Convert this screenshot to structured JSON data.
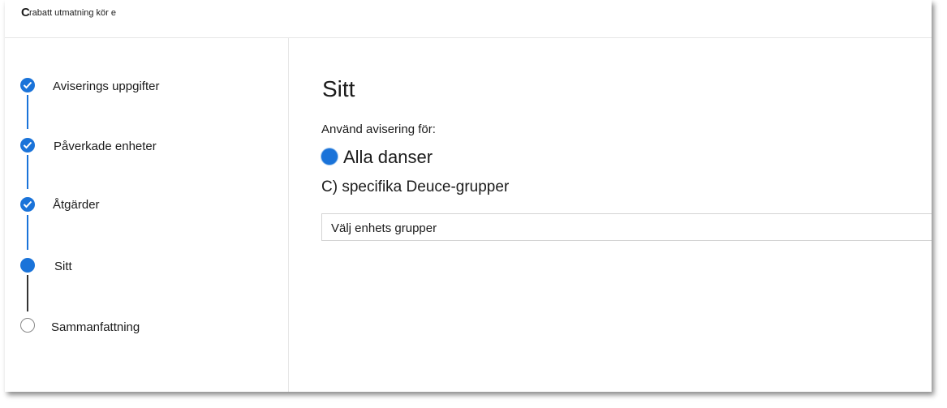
{
  "window": {
    "title_initial": "C",
    "title": "rabatt utmatning kör e"
  },
  "steps": [
    {
      "label": "Aviserings uppgifter",
      "state": "done"
    },
    {
      "label": "Påverkade enheter",
      "state": "done"
    },
    {
      "label": "Åtgärder",
      "state": "done"
    },
    {
      "label": "Sitt",
      "state": "current"
    },
    {
      "label": "Sammanfattning",
      "state": "pending"
    }
  ],
  "main": {
    "heading": "Sitt",
    "question": "Använd avisering för:",
    "option_all": "Alla danser",
    "option_specific": "C) specifika Deuce-grupper",
    "select_placeholder": "Välj enhets grupper"
  },
  "colors": {
    "accent": "#1a73d9",
    "border": "#d4d4d4",
    "text": "#1b1b1b"
  }
}
